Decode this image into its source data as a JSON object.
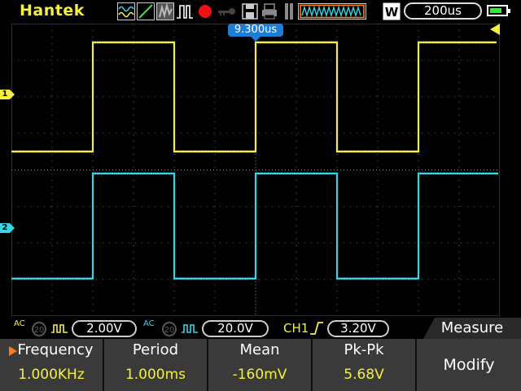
{
  "header": {
    "brand": "Hantek",
    "timebase": "200us",
    "trigger_position": "9.300us",
    "battery_level": 0.8,
    "icons": [
      "waveform-mode-icon",
      "ramp-icon",
      "persistence-icon",
      "pulse-icon",
      "record-icon",
      "key-icon",
      "save-icon",
      "print-icon",
      "memory-icon",
      "zoom-window-icon",
      "w-mode-icon",
      "battery-icon"
    ],
    "window_label": "W"
  },
  "channels": [
    {
      "id": "1",
      "color": "#f5f040",
      "volts_div": "2.00V",
      "coupling": "AC",
      "bw_limit": "20"
    },
    {
      "id": "2",
      "color": "#35d5e6",
      "volts_div": "20.0V",
      "coupling": "AC",
      "bw_limit": "20"
    }
  ],
  "trigger": {
    "source": "CH1",
    "level": "3.20V",
    "slope": "rising"
  },
  "menu": {
    "title": "Measure",
    "items": [
      {
        "label": "Frequency",
        "value": "1.000KHz",
        "selected": true
      },
      {
        "label": "Period",
        "value": "1.000ms"
      },
      {
        "label": "Mean",
        "value": "-160mV"
      },
      {
        "label": "Pk-Pk",
        "value": "5.68V"
      }
    ],
    "modify_label": "Modify"
  }
}
